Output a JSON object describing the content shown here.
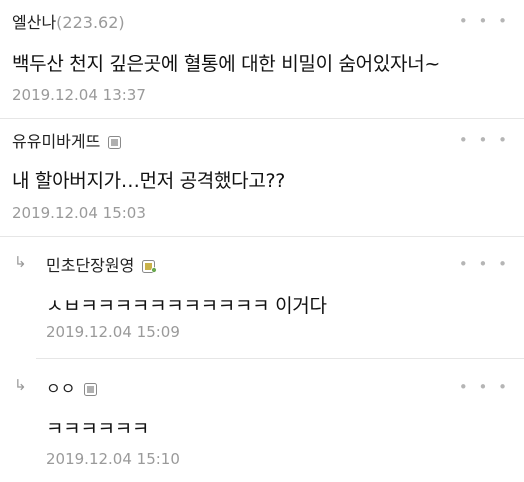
{
  "comments": [
    {
      "author": "엘산나",
      "ip": "(223.62)",
      "content": "백두산 천지 깊은곳에 혈통에 대한 비밀이 숨어있자너~",
      "time": "2019.12.04 13:37",
      "more": "• • •"
    },
    {
      "author": "유유미바게뜨",
      "content": "내 할아버지가…먼저 공격했다고??",
      "time": "2019.12.04 15:03",
      "more": "• • •"
    },
    {
      "author": "민초단장원영",
      "content": "ㅅㅂㅋㅋㅋㅋㅋㅋㅋㅋㅋㅋㅋ 이거다",
      "time": "2019.12.04 15:09",
      "more": "• • •",
      "reply_icon": "↳"
    },
    {
      "author": "ㅇㅇ",
      "content": "ㅋㅋㅋㅋㅋㅋ",
      "time": "2019.12.04 15:10",
      "more": "• • •",
      "reply_icon": "↳"
    }
  ],
  "icons": {
    "gallery_member": "gallery-member-icon",
    "fixed_nick": "fixed-nick-icon"
  }
}
